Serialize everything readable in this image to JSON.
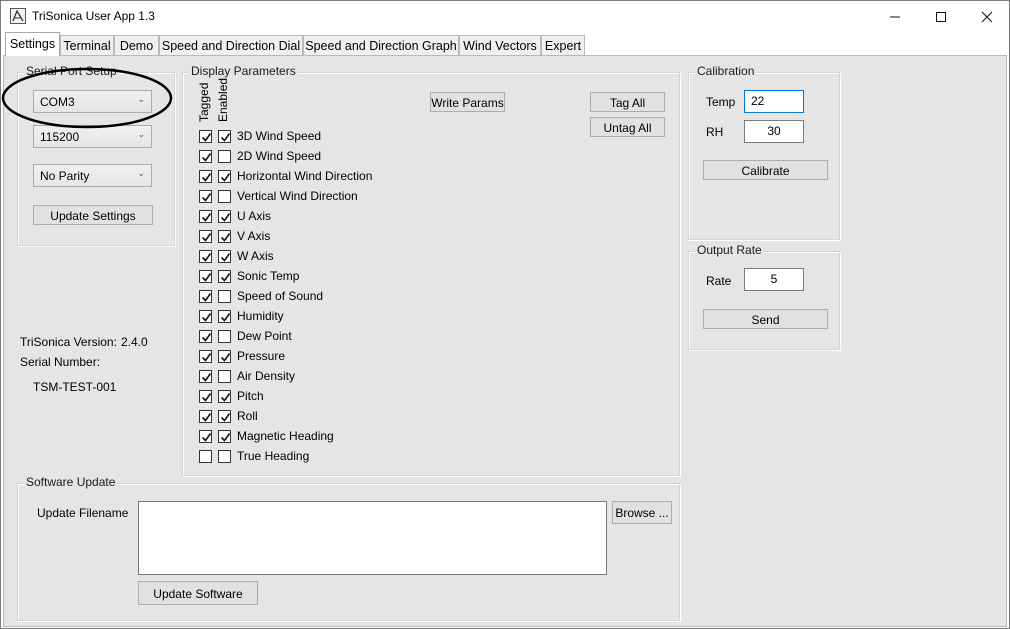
{
  "window": {
    "title": "TriSonica User App 1.3"
  },
  "tabs": [
    {
      "label": "Settings"
    },
    {
      "label": "Terminal"
    },
    {
      "label": "Demo"
    },
    {
      "label": "Speed and Direction Dial"
    },
    {
      "label": "Speed and Direction Graph"
    },
    {
      "label": "Wind Vectors"
    },
    {
      "label": "Expert"
    }
  ],
  "serial": {
    "title": "Serial Port Setup",
    "port": "COM3",
    "baud": "115200",
    "parity": "No Parity",
    "update_label": "Update Settings"
  },
  "info": {
    "version_label": "TriSonica Version:",
    "version_value": "2.4.0",
    "serial_label": "Serial Number:",
    "serial_value": "TSM-TEST-001"
  },
  "display": {
    "title": "Display Parameters",
    "tagged_header": "Tagged",
    "enabled_header": "Enabled",
    "write_label": "Write Params",
    "tag_all_label": "Tag All",
    "untag_all_label": "Untag All",
    "params": [
      {
        "label": "3D Wind Speed",
        "tagged": true,
        "enabled": true
      },
      {
        "label": "2D Wind Speed",
        "tagged": true,
        "enabled": false
      },
      {
        "label": "Horizontal Wind Direction",
        "tagged": true,
        "enabled": true
      },
      {
        "label": "Vertical Wind Direction",
        "tagged": true,
        "enabled": false
      },
      {
        "label": "U Axis",
        "tagged": true,
        "enabled": true
      },
      {
        "label": "V Axis",
        "tagged": true,
        "enabled": true
      },
      {
        "label": "W Axis",
        "tagged": true,
        "enabled": true
      },
      {
        "label": "Sonic Temp",
        "tagged": true,
        "enabled": true
      },
      {
        "label": "Speed of Sound",
        "tagged": true,
        "enabled": false
      },
      {
        "label": "Humidity",
        "tagged": true,
        "enabled": true
      },
      {
        "label": "Dew Point",
        "tagged": true,
        "enabled": false
      },
      {
        "label": "Pressure",
        "tagged": true,
        "enabled": true
      },
      {
        "label": "Air Density",
        "tagged": true,
        "enabled": false
      },
      {
        "label": "Pitch",
        "tagged": true,
        "enabled": true
      },
      {
        "label": "Roll",
        "tagged": true,
        "enabled": true
      },
      {
        "label": "Magnetic Heading",
        "tagged": true,
        "enabled": true
      },
      {
        "label": "True Heading",
        "tagged": false,
        "enabled": false
      }
    ]
  },
  "calibration": {
    "title": "Calibration",
    "temp_label": "Temp",
    "temp_value": "22",
    "rh_label": "RH",
    "rh_value": "30",
    "calibrate_label": "Calibrate"
  },
  "output": {
    "title": "Output Rate",
    "rate_label": "Rate",
    "rate_value": "5",
    "send_label": "Send"
  },
  "software": {
    "title": "Software Update",
    "filename_label": "Update Filename",
    "filename_value": "",
    "browse_label": "Browse ...",
    "update_label": "Update Software"
  }
}
